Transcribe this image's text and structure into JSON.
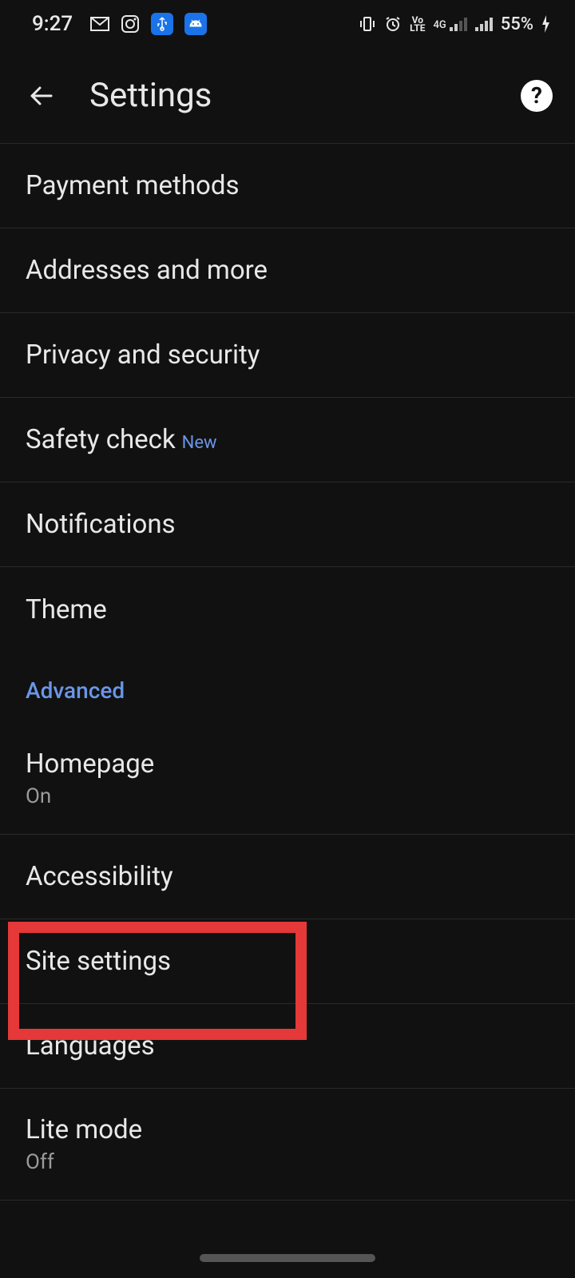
{
  "status": {
    "time": "9:27",
    "battery": "55%"
  },
  "header": {
    "title": "Settings"
  },
  "items": {
    "payment": "Payment methods",
    "addresses": "Addresses and more",
    "privacy": "Privacy and security",
    "safety": "Safety check",
    "safety_badge": "New",
    "notifications": "Notifications",
    "theme": "Theme"
  },
  "section": {
    "advanced": "Advanced"
  },
  "advanced_items": {
    "homepage": "Homepage",
    "homepage_sub": "On",
    "accessibility": "Accessibility",
    "site_settings": "Site settings",
    "languages": "Languages",
    "lite_mode": "Lite mode",
    "lite_mode_sub": "Off"
  }
}
